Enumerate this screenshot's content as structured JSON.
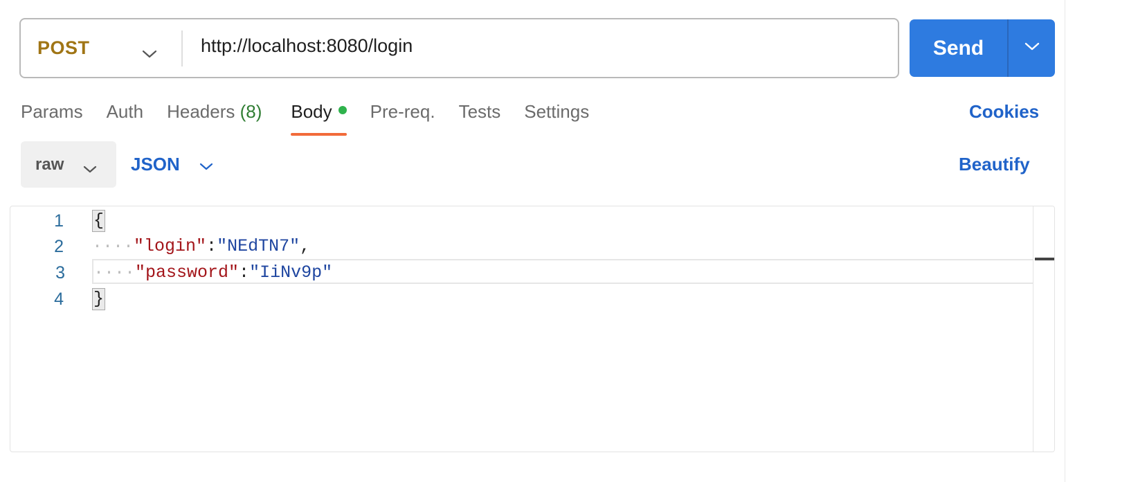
{
  "request": {
    "method": "POST",
    "url": "http://localhost:8080/login",
    "send_label": "Send"
  },
  "tabs": [
    {
      "label": "Params"
    },
    {
      "label": "Auth"
    },
    {
      "label": "Headers",
      "count": "(8)"
    },
    {
      "label": "Body",
      "active": true,
      "indicator": "green-dot"
    },
    {
      "label": "Pre-req."
    },
    {
      "label": "Tests"
    },
    {
      "label": "Settings"
    }
  ],
  "cookies_label": "Cookies",
  "body": {
    "mode": "raw",
    "language": "JSON",
    "beautify_label": "Beautify"
  },
  "editor": {
    "line_numbers": [
      "1",
      "2",
      "3",
      "4"
    ],
    "lines": [
      {
        "brace": "{"
      },
      {
        "indent": "····",
        "key": "\"login\"",
        "colon": ":",
        "value": "\"NEdTN7\"",
        "trailing": ","
      },
      {
        "indent": "····",
        "key": "\"password\"",
        "colon": ":",
        "value": "\"IiNv9p\"",
        "trailing": ""
      },
      {
        "brace": "}"
      }
    ],
    "current_line": 3
  },
  "colors": {
    "method": "#a07515",
    "send": "#2e7be0",
    "link": "#2063c9",
    "active_tab_underline": "#f26b3a",
    "body_dot": "#2fb24c",
    "headers_count": "#2f7d32",
    "json_key": "#a3151a",
    "json_value": "#1f46a0"
  },
  "icons": {
    "method_dropdown": "chevron-down-icon",
    "send_dropdown": "chevron-down-icon",
    "raw_dropdown": "chevron-down-icon",
    "json_dropdown": "chevron-down-icon"
  }
}
